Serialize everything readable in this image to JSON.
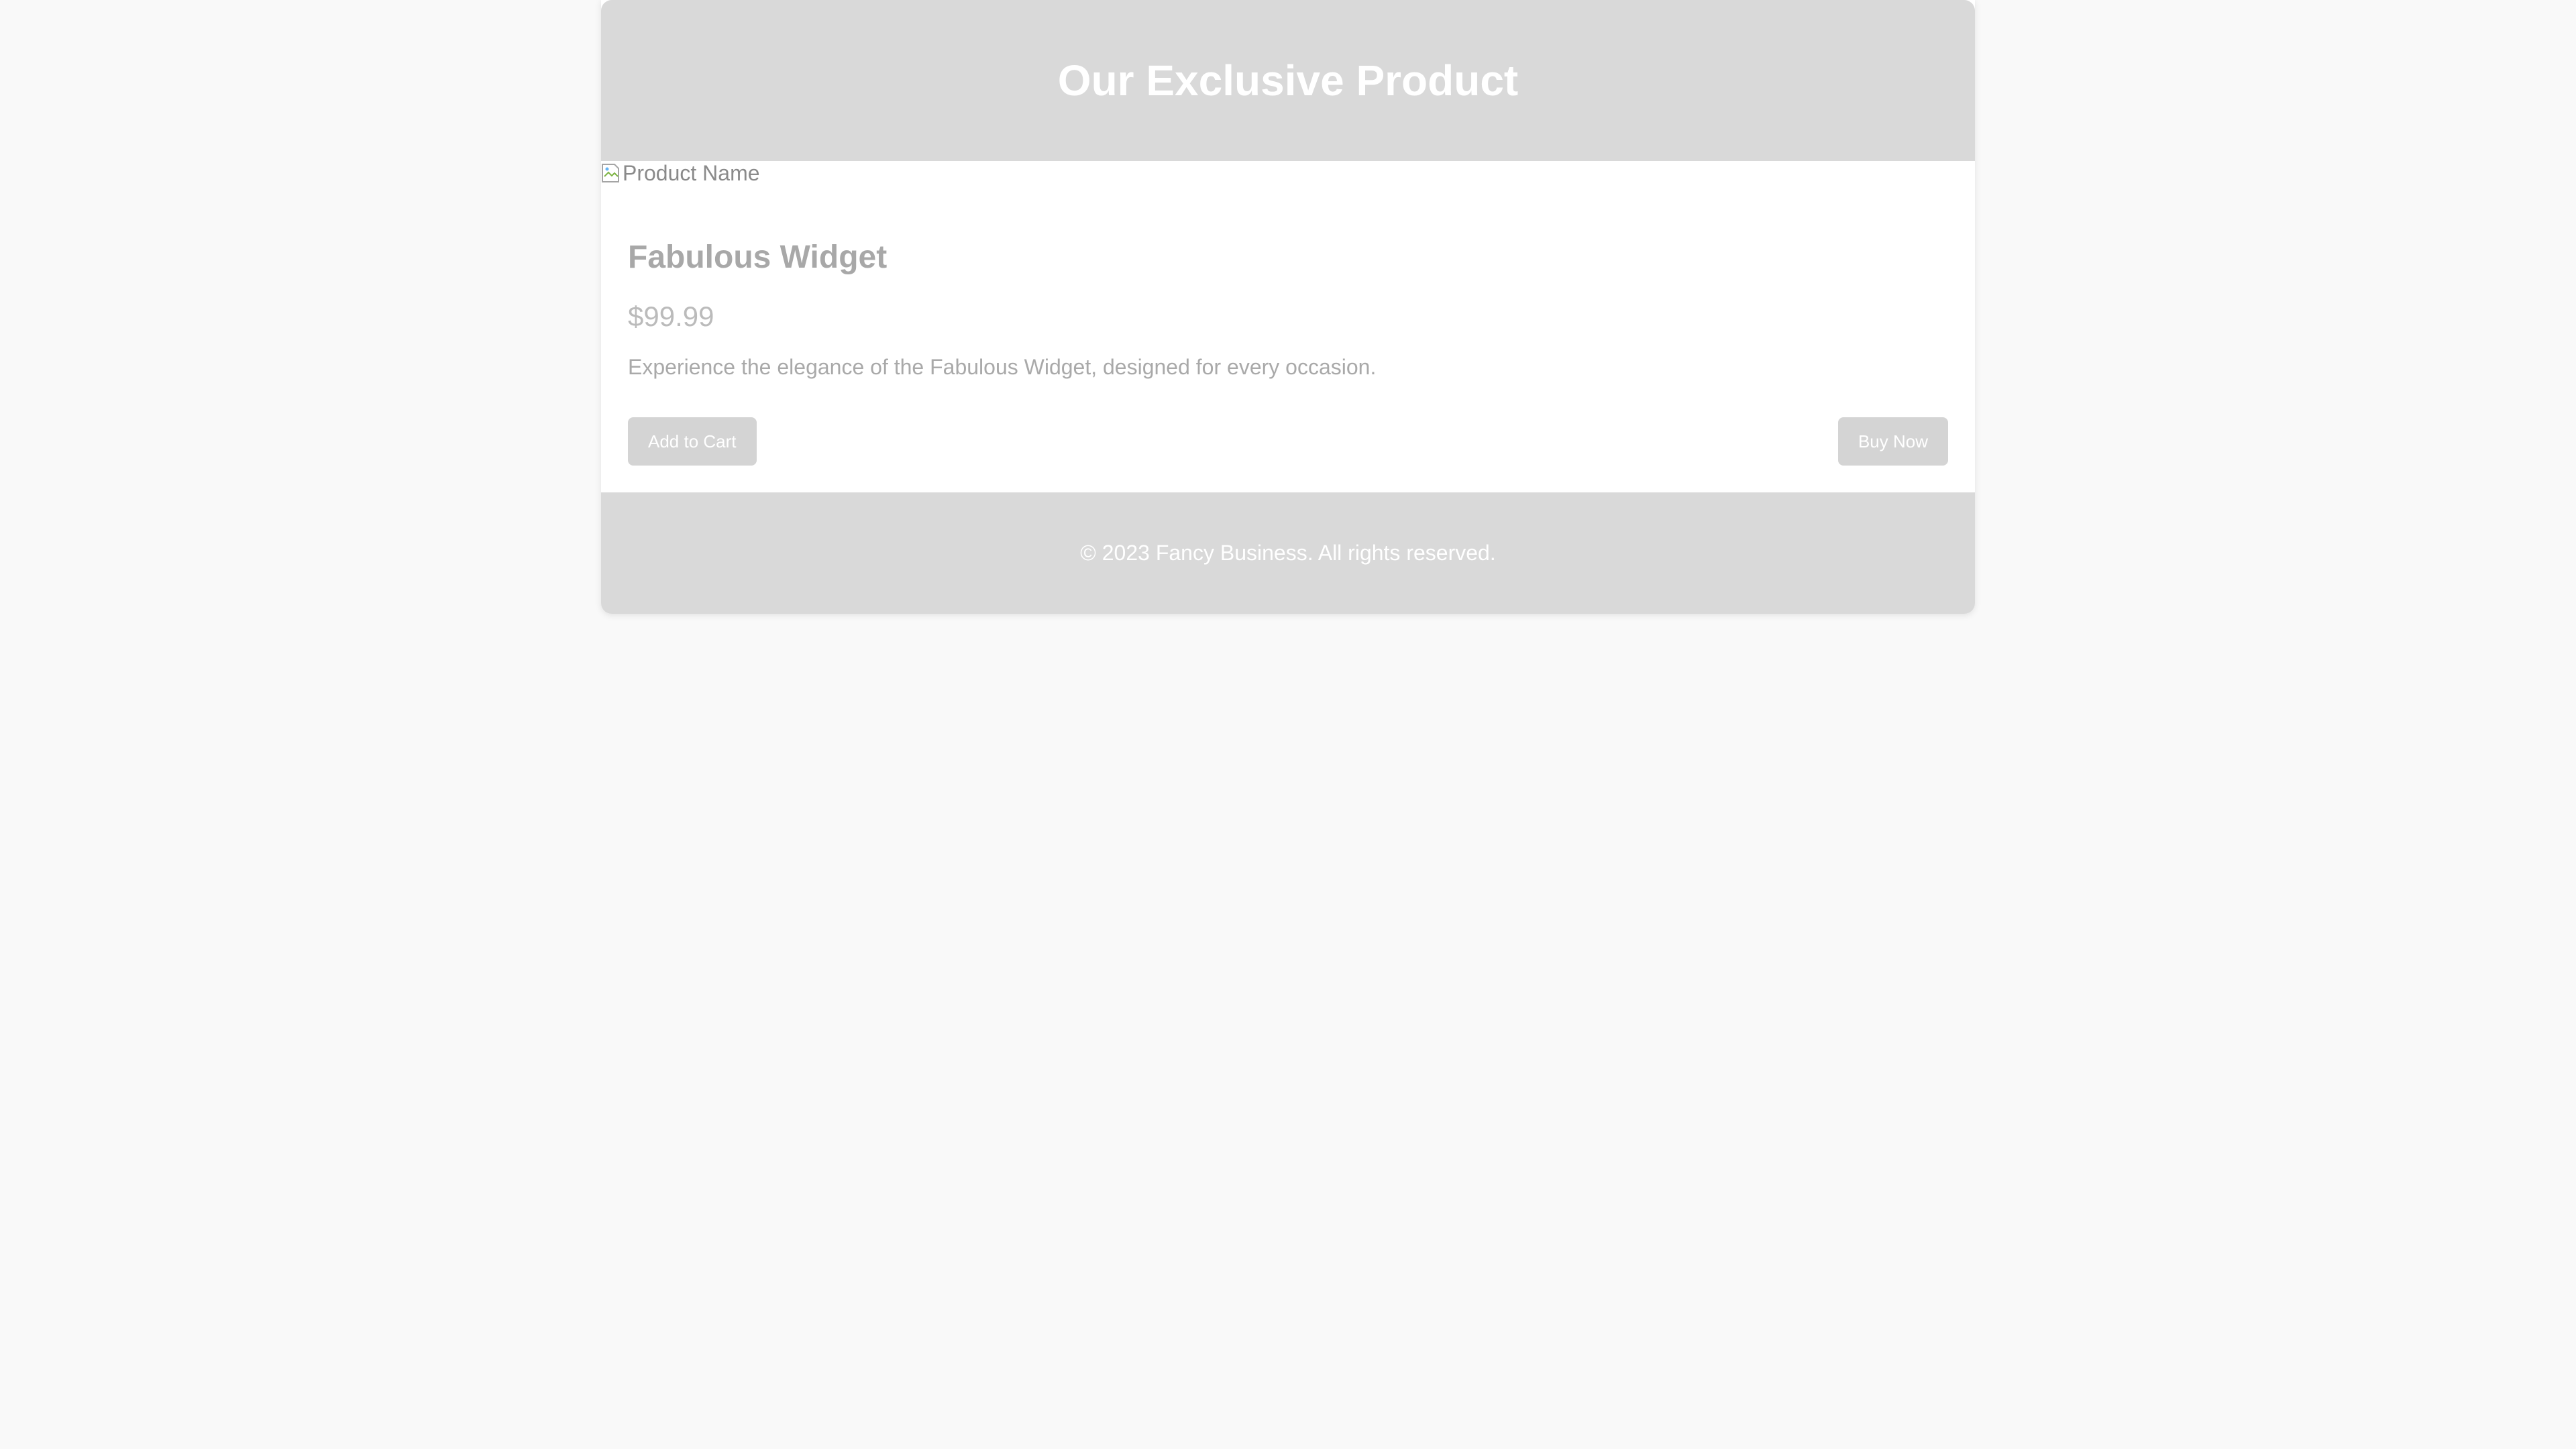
{
  "header": {
    "title": "Our Exclusive Product"
  },
  "product": {
    "image_alt": "Product Name",
    "name": "Fabulous Widget",
    "price": "$99.99",
    "description": "Experience the elegance of the Fabulous Widget, designed for every occasion."
  },
  "actions": {
    "add_to_cart_label": "Add to Cart",
    "buy_now_label": "Buy Now"
  },
  "footer": {
    "text": "© 2023 Fancy Business. All rights reserved."
  },
  "colors": {
    "page_background": "#f9f9f9",
    "header_footer_background": "#d9d9d9",
    "button_background": "#d4d4d4"
  },
  "icons": {
    "product_image": "broken-image-icon"
  }
}
